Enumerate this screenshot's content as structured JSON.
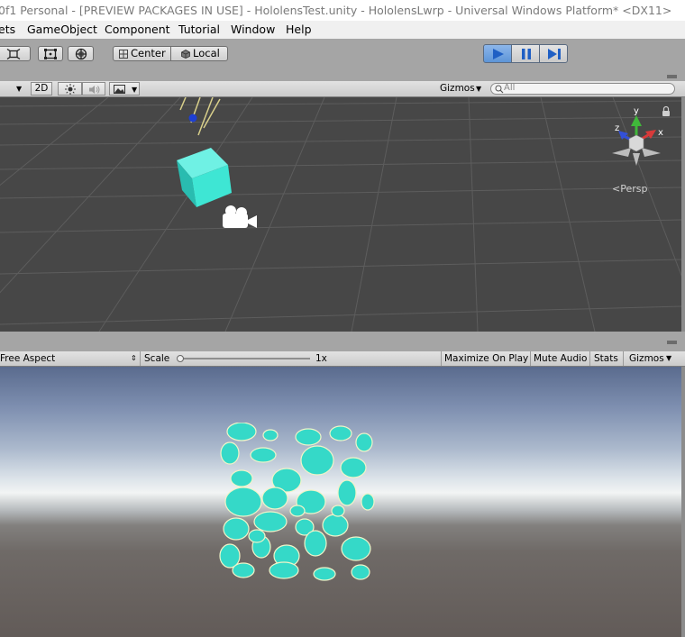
{
  "window": {
    "title": "0f1 Personal - [PREVIEW PACKAGES IN USE] - HololensTest.unity - HololensLwrp - Universal Windows Platform* <DX11>"
  },
  "menubar": {
    "items": [
      "ets",
      "GameObject",
      "Component",
      "Tutorial",
      "Window",
      "Help"
    ]
  },
  "toolbar": {
    "pivot_label": "Center",
    "space_label": "Local",
    "play_state": "playing",
    "accent_color": "#3d8bd8"
  },
  "scene": {
    "mode_2d_label": "2D",
    "gizmos_label": "Gizmos",
    "search_placeholder": "All",
    "projection_label": "Persp",
    "axis_labels": {
      "x": "x",
      "y": "y",
      "z": "z"
    }
  },
  "game": {
    "aspect_label": "Free Aspect",
    "scale_label": "Scale",
    "scale_value": "1x",
    "scale_slider_value": 0,
    "maximize_label": "Maximize On Play",
    "mute_label": "Mute Audio",
    "stats_label": "Stats",
    "gizmos_label": "Gizmos"
  },
  "colors": {
    "cube": "#3ee6d4",
    "pattern": "#35d9c8",
    "scene_bg": "#474747"
  }
}
